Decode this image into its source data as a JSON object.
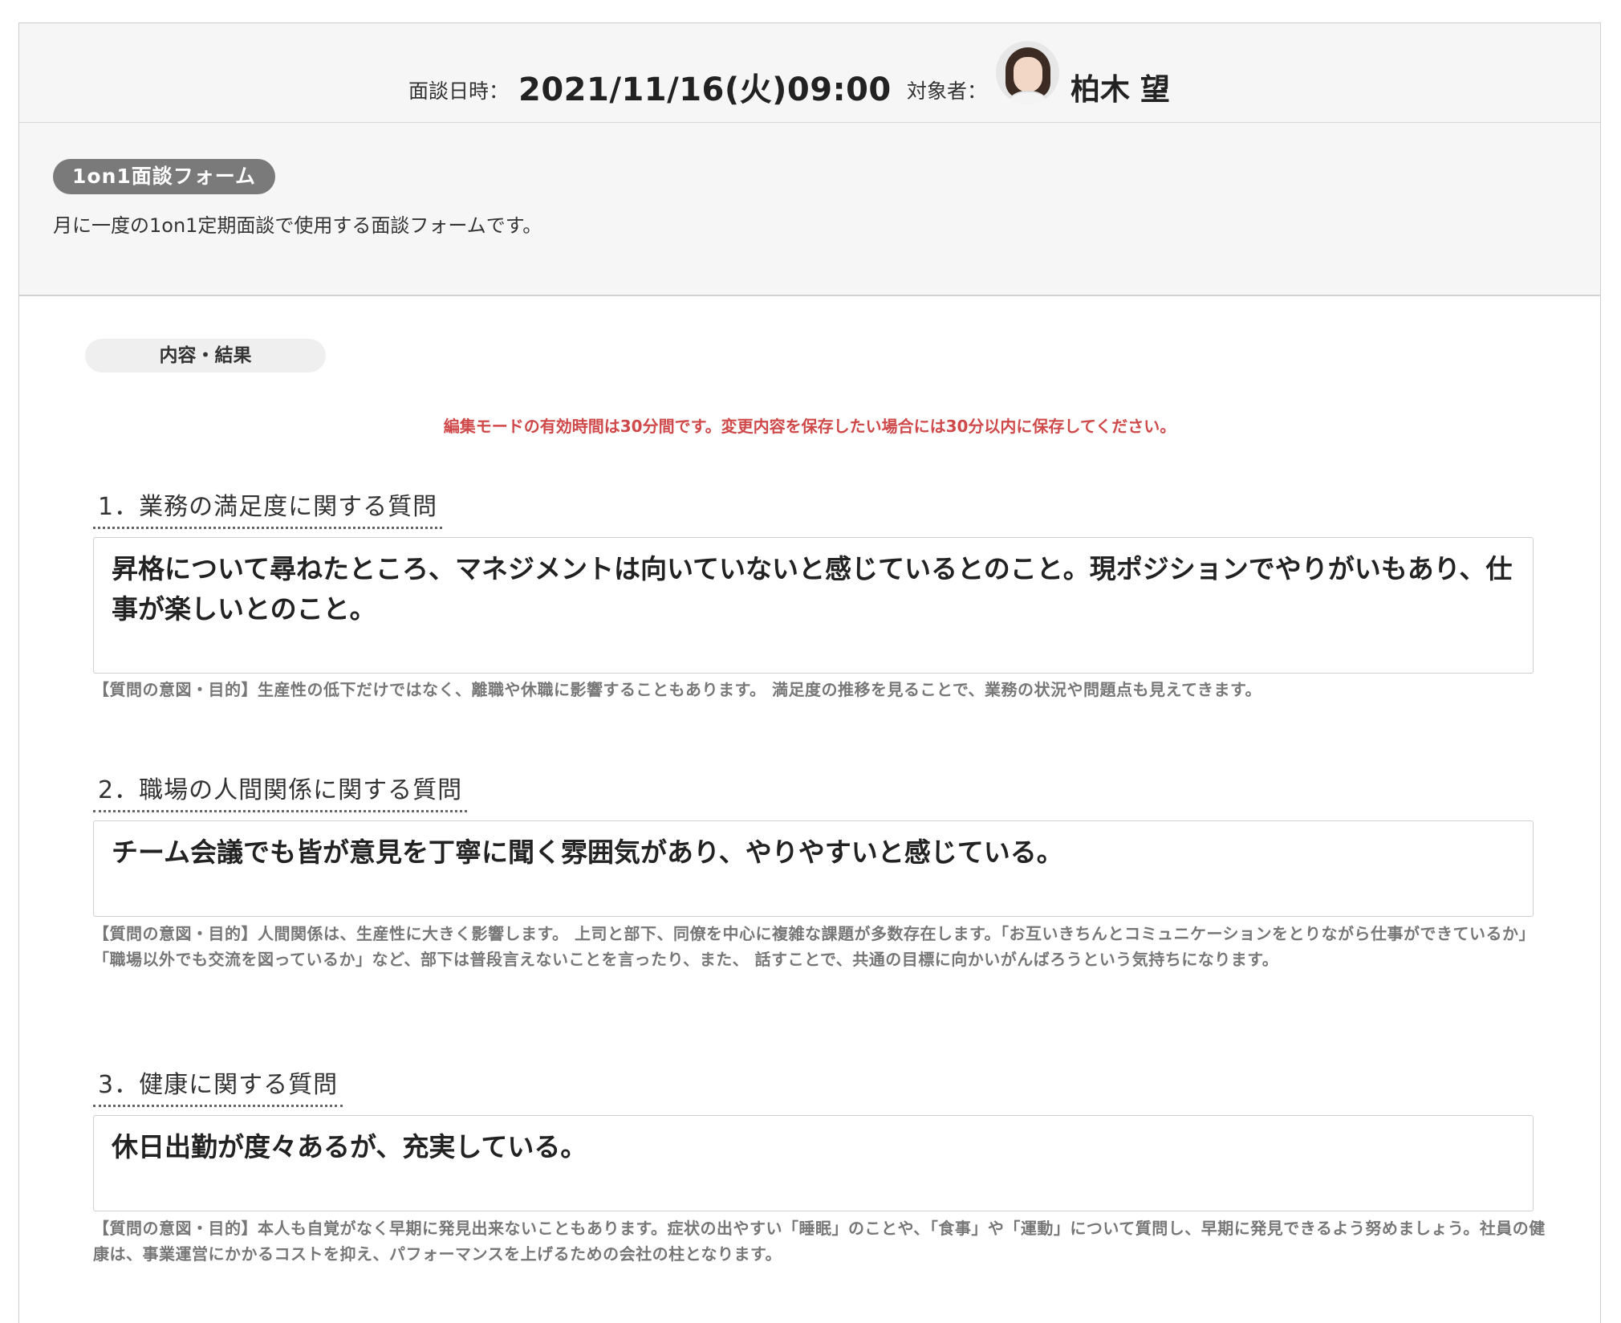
{
  "header": {
    "date_label": "面談日時：",
    "date_value": "2021/11/16(火)09:00",
    "target_label": "対象者：",
    "target_name": "柏木 望"
  },
  "form": {
    "badge": "1on1面談フォーム",
    "description": "月に一度の1on1定期面談で使用する面談フォームです。"
  },
  "section": {
    "tab_label": "内容・結果",
    "notice": "編集モードの有効時間は30分間です。変更内容を保存したい場合には30分以内に保存してください。"
  },
  "questions": [
    {
      "title": "1．業務の満足度に関する質問",
      "answer": "昇格について尋ねたところ、マネジメントは向いていないと感じているとのこと。現ポジションでやりがいもあり、仕事が楽しいとのこと。",
      "hint": "【質問の意図・目的】生産性の低下だけではなく、離職や休職に影響することもあります。 満足度の推移を見ることで、業務の状況や問題点も見えてきます。"
    },
    {
      "title": "2．職場の人間関係に関する質問",
      "answer": "チーム会議でも皆が意見を丁寧に聞く雰囲気があり、やりやすいと感じている。",
      "hint": "【質問の意図・目的】人間関係は、生産性に大きく影響します。 上司と部下、同僚を中心に複雑な課題が多数存在します。「お互いきちんとコミュニケーションをとりながら仕事ができているか」「職場以外でも交流を図っているか」など、部下は普段言えないことを言ったり、また、 話すことで、共通の目標に向かいがんばろうという気持ちになります。"
    },
    {
      "title": "3．健康に関する質問",
      "answer": "休日出勤が度々あるが、充実している。",
      "hint": "【質問の意図・目的】本人も自覚がなく早期に発見出来ないこともあります。症状の出やすい「睡眠」のことや、「食事」や「運動」について質問し、早期に発見できるよう努めましょう。社員の健康は、事業運営にかかるコストを抑え、パフォーマンスを上げるための会社の柱となります。"
    }
  ]
}
